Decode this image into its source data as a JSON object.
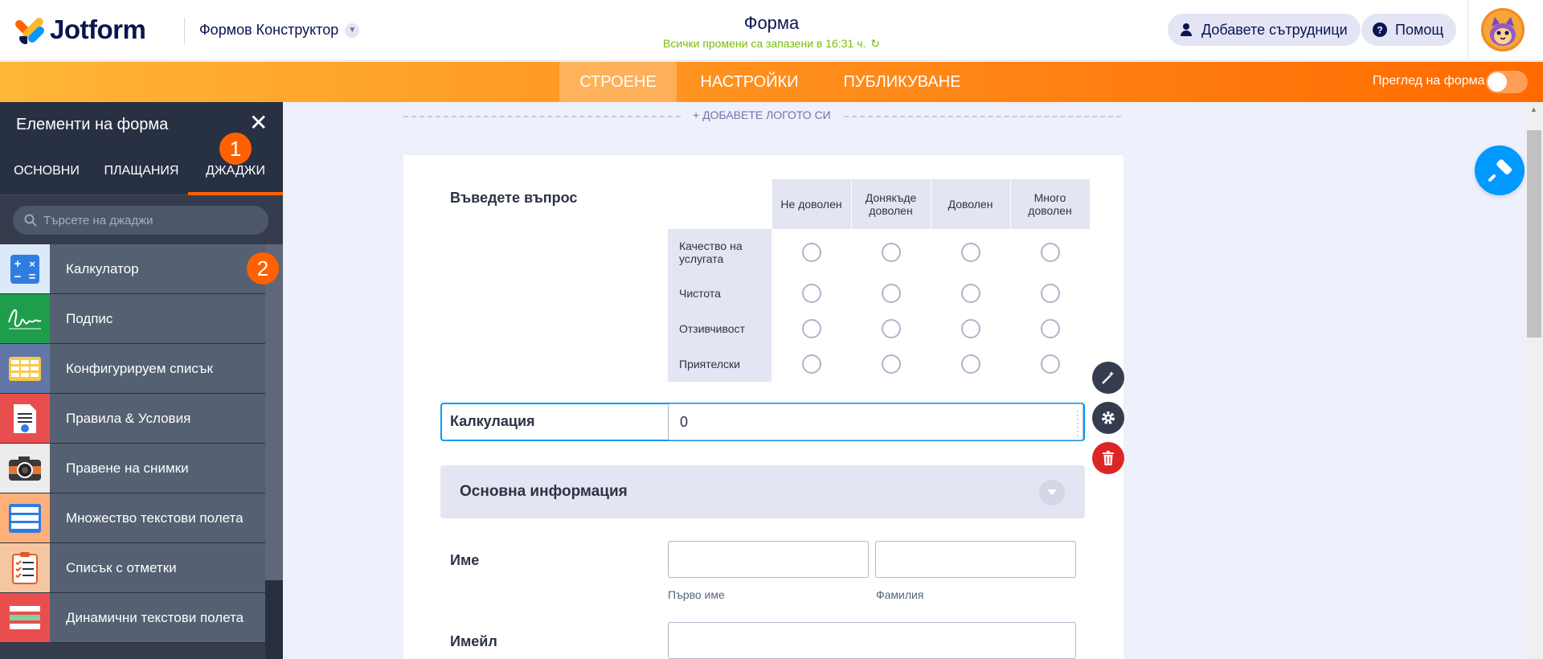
{
  "header": {
    "brand": "Jotform",
    "builder_menu": "Формов Конструктор",
    "form_title": "Форма",
    "save_status": "Всички промени са запазени в 16:31 ч.",
    "add_collaborators": "Добавете сътрудници",
    "help": "Помощ"
  },
  "nav": {
    "tabs": [
      {
        "label": "СТРОЕНЕ",
        "active": true
      },
      {
        "label": "НАСТРОЙКИ",
        "active": false
      },
      {
        "label": "ПУБЛИКУВАНЕ",
        "active": false
      }
    ],
    "preview_label": "Преглед на форма"
  },
  "panel": {
    "title": "Елементи на форма",
    "tabs": [
      {
        "label": "ОСНОВНИ",
        "active": false
      },
      {
        "label": "ПЛАЩАНИЯ",
        "active": false
      },
      {
        "label": "ДЖАДЖИ",
        "active": true
      }
    ],
    "search_placeholder": "Търсете на джаджи",
    "badges": [
      "1",
      "2"
    ],
    "widgets": [
      {
        "label": "Калкулатор",
        "icon": "calculator-icon"
      },
      {
        "label": "Подпис",
        "icon": "signature-icon"
      },
      {
        "label": "Конфигурируем списък",
        "icon": "configurable-list-icon"
      },
      {
        "label": "Правила & Условия",
        "icon": "terms-document-icon"
      },
      {
        "label": "Правене на снимки",
        "icon": "camera-icon"
      },
      {
        "label": "Множество текстови полета",
        "icon": "multiple-text-fields-icon"
      },
      {
        "label": "Списък с отметки",
        "icon": "checklist-icon"
      },
      {
        "label": "Динамични текстови полета",
        "icon": "dynamic-text-fields-icon"
      }
    ]
  },
  "canvas": {
    "add_logo": "+ ДОБАВЕТЕ ЛОГОТО СИ",
    "matrix": {
      "question": "Въведете въпрос",
      "columns": [
        "Не доволен",
        "Донякъде доволен",
        "Доволен",
        "Много доволен"
      ],
      "rows": [
        "Качество на услугата",
        "Чистота",
        "Отзивчивост",
        "Приятелски"
      ]
    },
    "calculation": {
      "label": "Калкулация",
      "value": "0"
    },
    "section_title": "Основна информация",
    "name_field": {
      "label": "Име",
      "first_sublabel": "Първо име",
      "last_sublabel": "Фамилия"
    },
    "email_field": {
      "label": "Имейл"
    }
  },
  "colors": {
    "brand_orange": "#ff6100",
    "accent_blue": "#0099ff",
    "panel_bg": "#343c4e",
    "save_green": "#78bb07"
  }
}
